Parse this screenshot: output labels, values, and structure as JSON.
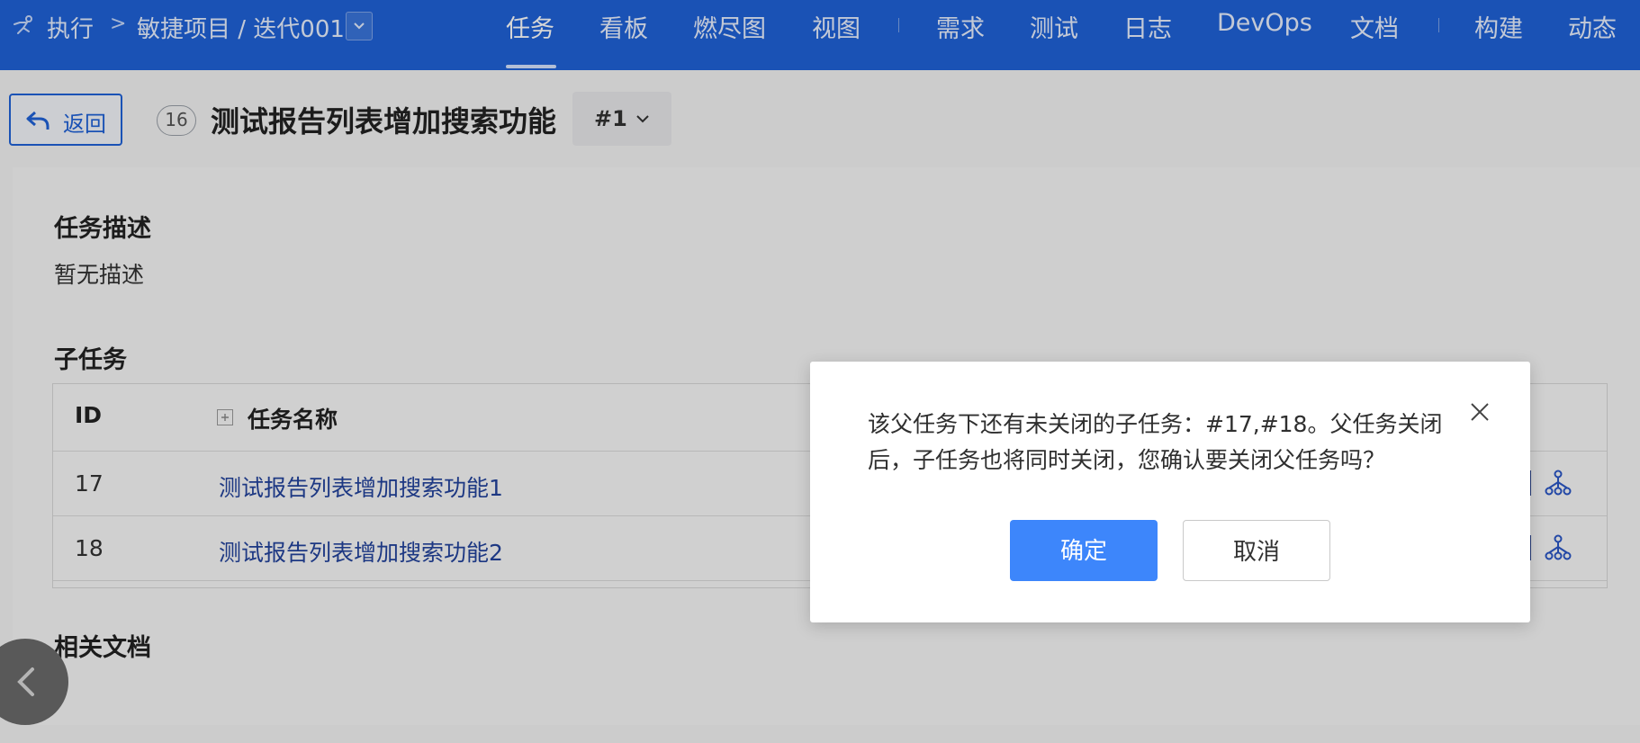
{
  "topbar": {
    "breadcrumb": {
      "run_label": "执行",
      "separator": ">",
      "project": "敏捷项目 / 迭代001"
    },
    "nav": [
      {
        "label": "任务",
        "active": true
      },
      {
        "label": "看板"
      },
      {
        "label": "燃尽图"
      },
      {
        "label": "视图"
      },
      {
        "label": "需求"
      },
      {
        "label": "测试"
      },
      {
        "label": "日志"
      },
      {
        "label": "DevOps"
      },
      {
        "label": "文档"
      },
      {
        "label": "构建"
      },
      {
        "label": "动态"
      }
    ]
  },
  "header": {
    "back_label": "返回",
    "task_number": "16",
    "task_title": "测试报告列表增加搜索功能",
    "version_label": "#1"
  },
  "content": {
    "description_title": "任务描述",
    "description_text": "暂无描述",
    "subtasks_title": "子任务",
    "table": {
      "columns": [
        "ID",
        "任务名称"
      ],
      "rows": [
        {
          "id": "17",
          "name": "测试报告列表增加搜索功能1"
        },
        {
          "id": "18",
          "name": "测试报告列表增加搜索功能2"
        }
      ]
    },
    "docs_title": "相关文档"
  },
  "dialog": {
    "message": "该父任务下还有未关闭的子任务：#17,#18。父任务关闭后，子任务也将同时关闭，您确认要关闭父任务吗？",
    "confirm_label": "确定",
    "cancel_label": "取消"
  },
  "colors": {
    "brand_blue": "#1f62d8",
    "primary_button": "#3d86fb",
    "link": "#23439c"
  }
}
